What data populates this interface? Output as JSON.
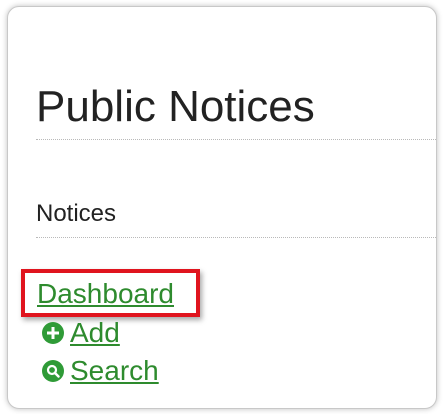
{
  "panel": {
    "title": "Public Notices",
    "section_label": "Notices",
    "links": {
      "dashboard": "Dashboard",
      "add": "Add",
      "search": "Search"
    }
  },
  "colors": {
    "link": "#2e8b2e",
    "icon": "#2f9b37",
    "highlight": "#e0141e"
  },
  "icons": {
    "add": "plus-circle-icon",
    "search": "search-circle-icon"
  }
}
